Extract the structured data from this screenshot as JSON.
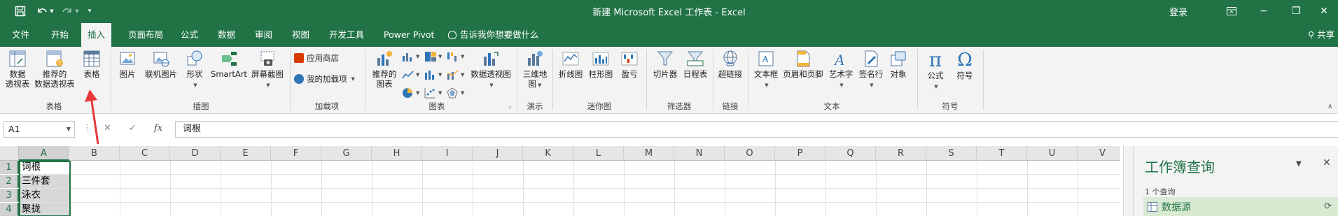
{
  "window": {
    "title": "新建 Microsoft Excel 工作表 - Excel",
    "login_label": "登录",
    "save_icon": "save-icon",
    "undo_icon": "undo-icon",
    "redo_icon": "redo-icon",
    "customize_icon": "customize-qat-icon",
    "ribbon_display_icon": "ribbon-display-icon",
    "minimize_label": "−",
    "restore_label": "❐",
    "close_label": "✕"
  },
  "tabs": [
    {
      "label": "文件"
    },
    {
      "label": "开始"
    },
    {
      "label": "插入",
      "active": true
    },
    {
      "label": "页面布局"
    },
    {
      "label": "公式"
    },
    {
      "label": "数据"
    },
    {
      "label": "审阅"
    },
    {
      "label": "视图"
    },
    {
      "label": "开发工具"
    },
    {
      "label": "Power Pivot"
    }
  ],
  "tell_me": "告诉我你想要做什么",
  "share_label": "共享",
  "ribbon": {
    "groups": {
      "tables": "表格",
      "illustrations": "插图",
      "addins": "加载项",
      "charts": "图表",
      "tours": "演示",
      "sparklines": "迷你图",
      "filters": "筛选器",
      "links": "链接",
      "text": "文本",
      "symbols": "符号"
    },
    "buttons": {
      "pivot_table": [
        "数据",
        "透视表"
      ],
      "recommended_pivot": [
        "推荐的",
        "数据透视表"
      ],
      "table": "表格",
      "pictures": "图片",
      "online_pictures": "联机图片",
      "shapes": "形状",
      "smartart": "SmartArt",
      "screenshot": "屏幕截图",
      "store": "应用商店",
      "my_addins": "我的加载项",
      "recommended_charts": [
        "推荐的",
        "图表"
      ],
      "pivot_chart": "数据透视图",
      "map_3d": [
        "三维地",
        "图"
      ],
      "line_spark": "折线图",
      "column_spark": "柱形图",
      "winloss": "盈亏",
      "slicer": "切片器",
      "timeline": "日程表",
      "hyperlink": "超链接",
      "textbox": "文本框",
      "header_footer": "页眉和页脚",
      "wordart": "艺术字",
      "signature": "签名行",
      "object": "对象",
      "equation": "公式",
      "symbol": "符号"
    }
  },
  "formula_bar": {
    "name_box": "A1",
    "fx_label": "fx",
    "cancel_label": "✕",
    "enter_label": "✓",
    "content": "词根"
  },
  "grid": {
    "columns": [
      "A",
      "B",
      "C",
      "D",
      "E",
      "F",
      "G",
      "H",
      "I",
      "J",
      "K",
      "L",
      "M",
      "N",
      "O",
      "P",
      "Q",
      "R",
      "S",
      "T",
      "U",
      "V"
    ],
    "rows": [
      "1",
      "2",
      "3",
      "4"
    ],
    "cells_a": [
      "词根",
      "三件套",
      "泳衣",
      "聚拢"
    ]
  },
  "query_pane": {
    "title": "工作簿查询",
    "count": "1 个查询",
    "source": "数据源"
  },
  "colors": {
    "brand_green": "#217346",
    "annotation_red": "#e8383b"
  }
}
